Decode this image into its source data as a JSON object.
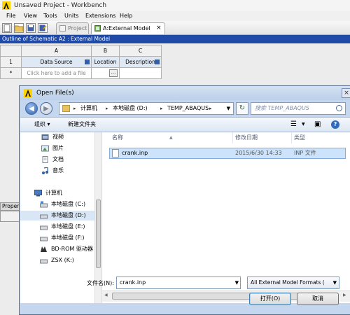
{
  "workbench": {
    "title": "Unsaved Project - Workbench",
    "menu": [
      "File",
      "View",
      "Tools",
      "Units",
      "Extensions",
      "Help"
    ],
    "tabs": [
      {
        "label": "Project"
      },
      {
        "label": "A:External Model"
      }
    ],
    "tab_close": "×",
    "outline_title": "Outline of Schematic A2 : External Model",
    "table": {
      "col_letters": [
        "A",
        "B",
        "C"
      ],
      "headers": [
        "Data Source",
        "Location",
        "Description"
      ],
      "row1_num": "1",
      "row2_marker": "*",
      "add_file_placeholder": "Click here to add a file",
      "browse_label": "..."
    },
    "properties_label": "Properties"
  },
  "dialog": {
    "title": "Open File(s)",
    "close": "×",
    "breadcrumbs": [
      "计算机",
      "本地磁盘 (D:)",
      "TEMP_ABAQUS"
    ],
    "search_placeholder": "搜索 TEMP_ABAQUS",
    "organize_label": "组织 ▾",
    "new_folder_label": "新建文件夹",
    "nav_items": [
      {
        "label": "视频",
        "icon": "video-icon"
      },
      {
        "label": "图片",
        "icon": "pictures-icon"
      },
      {
        "label": "文档",
        "icon": "documents-icon"
      },
      {
        "label": "音乐",
        "icon": "music-icon"
      },
      {
        "label": "计算机",
        "icon": "computer-icon"
      },
      {
        "label": "本地磁盘 (C:)",
        "icon": "drive-icon"
      },
      {
        "label": "本地磁盘 (D:)",
        "icon": "drive-icon"
      },
      {
        "label": "本地磁盘 (E:)",
        "icon": "drive-icon"
      },
      {
        "label": "本地磁盘 (F:)",
        "icon": "drive-icon"
      },
      {
        "label": "BD-ROM 驱动器",
        "icon": "optical-drive-icon"
      },
      {
        "label": "ZSX (K:)",
        "icon": "drive-icon"
      }
    ],
    "columns": [
      "名称",
      "修改日期",
      "类型"
    ],
    "files": [
      {
        "name": "crank.inp",
        "modified": "2015/6/30 14:33",
        "type": "INP 文件"
      }
    ],
    "filename_label": "文件名(N):",
    "filename_value": "crank.inp",
    "filter_value": "All External Model Formats (",
    "open_button": "打开(O)",
    "cancel_button": "取消"
  },
  "colors": {
    "outline_header": "#1f4aa8",
    "selection": "#cce3fb"
  }
}
